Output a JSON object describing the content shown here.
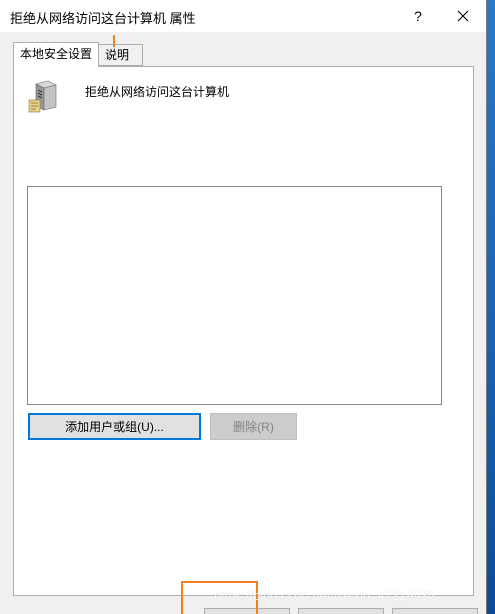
{
  "window": {
    "title": "拒绝从网络访问这台计算机 属性",
    "help_label": "?",
    "close_label": "✕"
  },
  "tabs": [
    {
      "label": "本地安全设置",
      "active": true
    },
    {
      "label": "说明",
      "active": false
    }
  ],
  "panel": {
    "policy_name": "拒绝从网络访问这台计算机",
    "policy_icon": "server-icon",
    "members_list": []
  },
  "buttons": {
    "add_label": "添加用户或组(U)...",
    "remove_label": "删除(R)"
  },
  "watermark": "https://blog.csdn.net/weixin_47219935",
  "colors": {
    "accent_focus": "#0078d7",
    "annotation": "#f08020"
  }
}
